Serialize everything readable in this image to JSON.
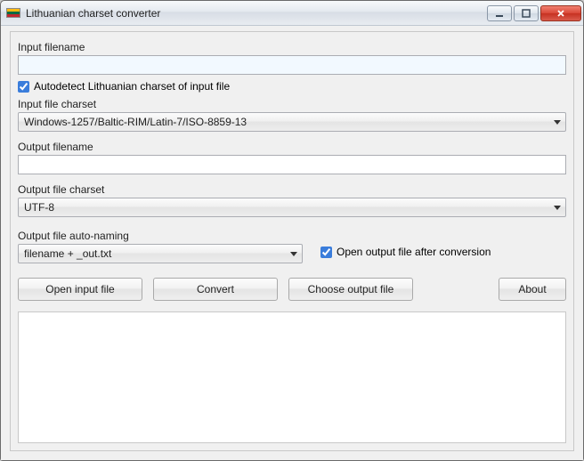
{
  "window": {
    "title": "Lithuanian charset converter"
  },
  "labels": {
    "input_filename": "Input filename",
    "autodetect": "Autodetect Lithuanian charset of input file",
    "input_charset": "Input file charset",
    "output_filename": "Output filename",
    "output_charset": "Output file charset",
    "auto_naming": "Output file auto-naming",
    "open_after": "Open output file after conversion"
  },
  "values": {
    "input_filename": "",
    "autodetect_checked": true,
    "input_charset": "Windows-1257/Baltic-RIM/Latin-7/ISO-8859-13",
    "output_filename": "",
    "output_charset": "UTF-8",
    "auto_naming": "filename + _out.txt",
    "open_after_checked": true
  },
  "buttons": {
    "open_input": "Open input file",
    "convert": "Convert",
    "choose_output": "Choose output file",
    "about": "About"
  },
  "log_text": ""
}
